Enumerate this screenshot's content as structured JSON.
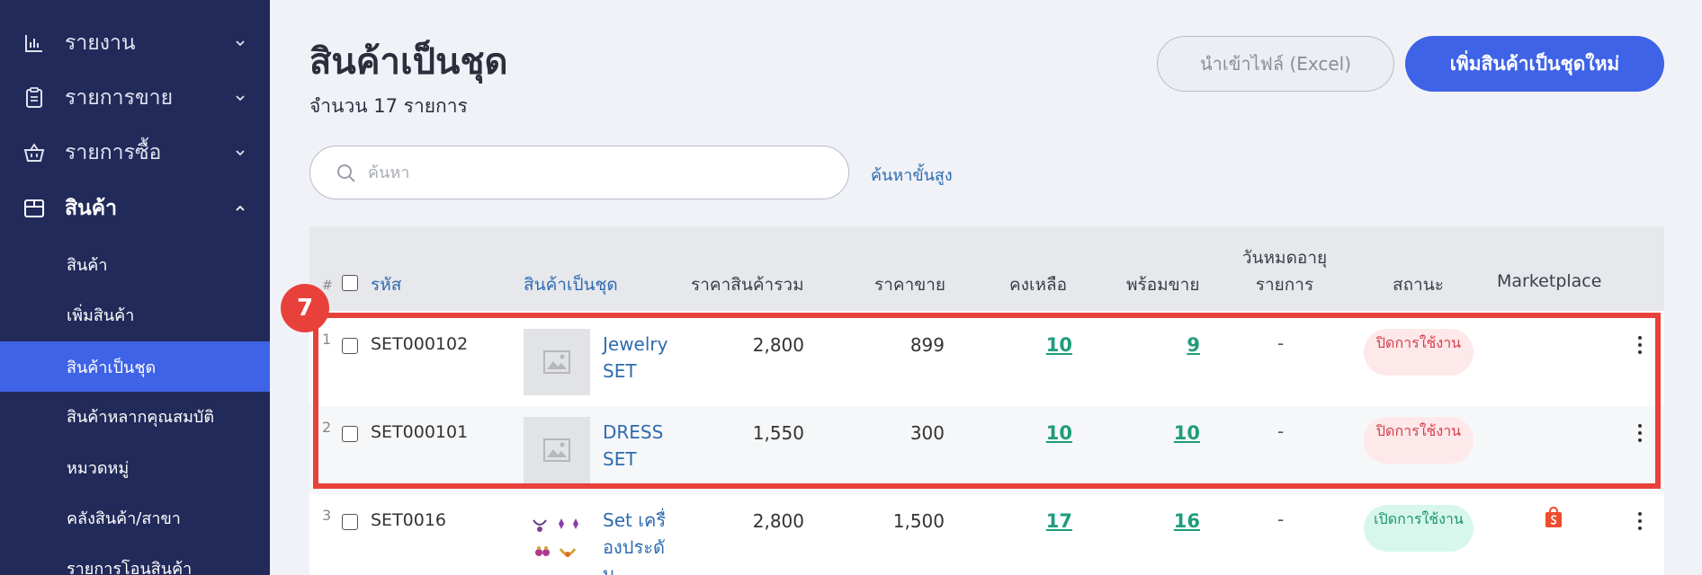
{
  "sidebar": {
    "items": [
      {
        "label": "รายงาน",
        "icon": "bar-chart-icon"
      },
      {
        "label": "รายการขาย",
        "icon": "clipboard-icon"
      },
      {
        "label": "รายการซื้อ",
        "icon": "basket-icon"
      },
      {
        "label": "สินค้า",
        "icon": "box-icon"
      }
    ],
    "sub_items": [
      {
        "label": "สินค้า"
      },
      {
        "label": "เพิ่มสินค้า"
      },
      {
        "label": "สินค้าเป็นชุด"
      },
      {
        "label": "สินค้าหลากคุณสมบัติ"
      },
      {
        "label": "หมวดหมู่"
      },
      {
        "label": "คลังสินค้า/สาขา"
      },
      {
        "label": "รายการโอนสินค้า"
      }
    ]
  },
  "header": {
    "title": "สินค้าเป็นชุด",
    "count": "จำนวน 17 รายการ",
    "import_button": "นำเข้าไฟล์ (Excel)",
    "add_button": "เพิ่มสินค้าเป็นชุดใหม่"
  },
  "search": {
    "placeholder": "ค้นหา",
    "advanced": "ค้นหาขั้นสูง"
  },
  "table": {
    "headers": {
      "hash": "#",
      "code": "รหัส",
      "bundle": "สินค้าเป็นชุด",
      "total_price": "ราคาสินค้ารวม",
      "sell_price": "ราคาขาย",
      "remaining": "คงเหลือ",
      "ready": "พร้อมขาย",
      "expiry_1": "วันหมดอายุ",
      "expiry_2": "รายการ",
      "status": "สถานะ",
      "marketplace": "Marketplace"
    },
    "rows": [
      {
        "no": "1",
        "code": "SET000102",
        "name": "Jewelry SET",
        "total": "2,800",
        "sell": "899",
        "remaining": "10",
        "ready": "9",
        "expiry": "-",
        "status": "ปิดการใช้งาน",
        "status_color": "#d4404c"
      },
      {
        "no": "2",
        "code": "SET000101",
        "name": "DRESS SET",
        "total": "1,550",
        "sell": "300",
        "remaining": "10",
        "ready": "10",
        "expiry": "-",
        "status": "ปิดการใช้งาน",
        "status_color": "#d4404c"
      },
      {
        "no": "3",
        "code": "SET0016",
        "name": "Set เครื่องประดับ",
        "total": "2,800",
        "sell": "1,500",
        "remaining": "17",
        "ready": "16",
        "expiry": "-",
        "status": "เปิดการใช้งาน",
        "status_color": "#19966e",
        "marketplace_icon": "shopee-bag-icon"
      }
    ]
  },
  "annotation": {
    "step": "7",
    "color": "#e8413b"
  },
  "colors": {
    "sidebar_bg": "#222a5a",
    "accent": "#3f63e6",
    "link": "#2f6bb0",
    "stock_link": "#1e9d7a"
  }
}
